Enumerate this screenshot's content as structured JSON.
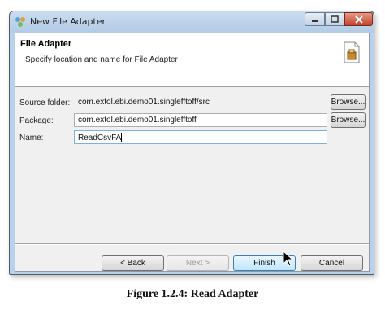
{
  "window": {
    "title": "New File Adapter"
  },
  "banner": {
    "title": "File Adapter",
    "subtitle": "Specify location and name for File Adapter"
  },
  "form": {
    "source_folder": {
      "label": "Source folder:",
      "value": "com.extol.ebi.demo01.singlefftoff/src",
      "button": "Browse..."
    },
    "package": {
      "label": "Package:",
      "value": "com.extol.ebi.demo01.singlefftoff",
      "button": "Browse..."
    },
    "name": {
      "label": "Name:",
      "value": "ReadCsvFA"
    }
  },
  "buttons": {
    "back": "< Back",
    "next": "Next >",
    "finish": "Finish",
    "cancel": "Cancel"
  },
  "caption": "Figure 1.2.4: Read Adapter",
  "icons": {
    "app": "file-adapter-icon",
    "banner": "file-wizard-icon",
    "minimize": "minimize-icon",
    "maximize": "maximize-icon",
    "close": "close-icon",
    "cursor": "mouse-pointer-icon"
  },
  "colors": {
    "titlebar": "#b9d1ea",
    "close_button": "#c2432b",
    "default_button": "#bee6fd"
  }
}
